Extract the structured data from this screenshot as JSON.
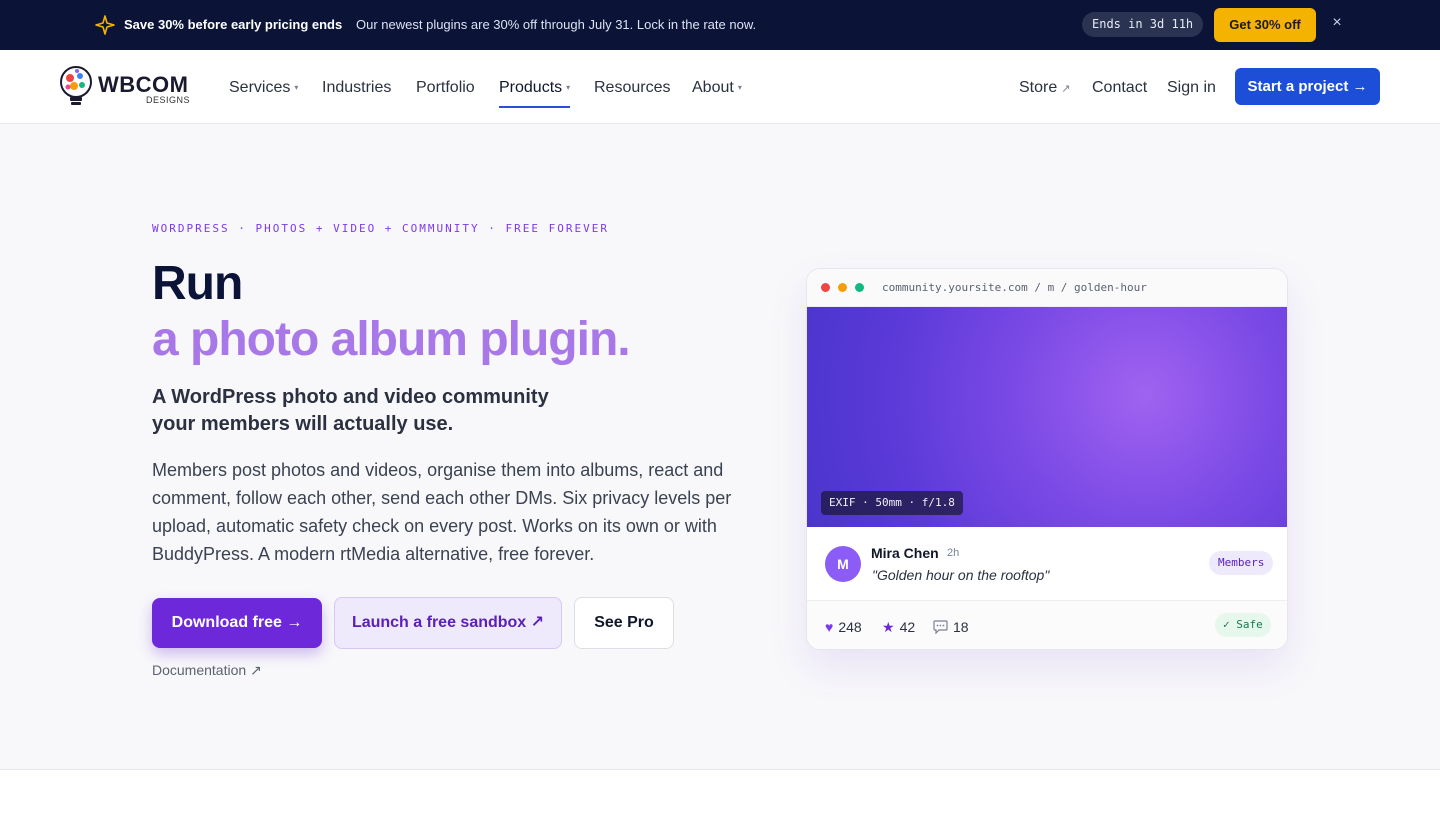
{
  "promo": {
    "title": "Save 30% before early pricing ends",
    "text": "Our newest plugins are 30% off through July 31. Lock in the rate now.",
    "countdown": "Ends in 3d 11h",
    "deal_label": "Get 30% off",
    "close_glyph": "×"
  },
  "header": {
    "brand": "WBCOM",
    "brand_sub": "DESIGNS",
    "nav": {
      "services": "Services",
      "industries": "Industries",
      "portfolio": "Portfolio",
      "products": "Products",
      "resources": "Resources",
      "about": "About"
    },
    "right": {
      "store": "Store",
      "contact": "Contact",
      "signin": "Sign in",
      "cta": "Start a project →"
    },
    "ext_glyph": "↗",
    "caret_glyph": "▾"
  },
  "hero": {
    "eyebrow": "WORDPRESS · PHOTOS + VIDEO + COMMUNITY · FREE FOREVER",
    "h1_line1": "Run",
    "h1_line2": "a photo album plugin.",
    "subhead": "A WordPress photo and video community your members will actually use.",
    "body": "Members post photos and videos, organise them into albums, react and comment, follow each other, send each other DMs. Six privacy levels per upload, automatic safety check on every post. Works on its own or with BuddyPress. A modern rtMedia alternative, free forever.",
    "btn_download": "Download free  →",
    "btn_sandbox": "Launch a free sandbox  ↗",
    "btn_pro": "See Pro",
    "doc_link": "Documentation ↗"
  },
  "card": {
    "url": "community.yoursite.com / m / golden-hour",
    "exif": "EXIF · 50mm · f/1.8",
    "avatar_initial": "M",
    "user_name": "Mira Chen",
    "time": "2h",
    "caption": "\"Golden hour on the rooftop\"",
    "badge": "Members",
    "likes": "248",
    "stars": "42",
    "comments": "18",
    "safe": "✓ Safe",
    "dot_colors": [
      "#ef4444",
      "#f59e0b",
      "#10b981"
    ]
  },
  "colors": {
    "accent": "#6d28d9",
    "primary_cta": "#1d4ed8",
    "promo_bg": "#0b1437",
    "deal": "#f5b301"
  }
}
